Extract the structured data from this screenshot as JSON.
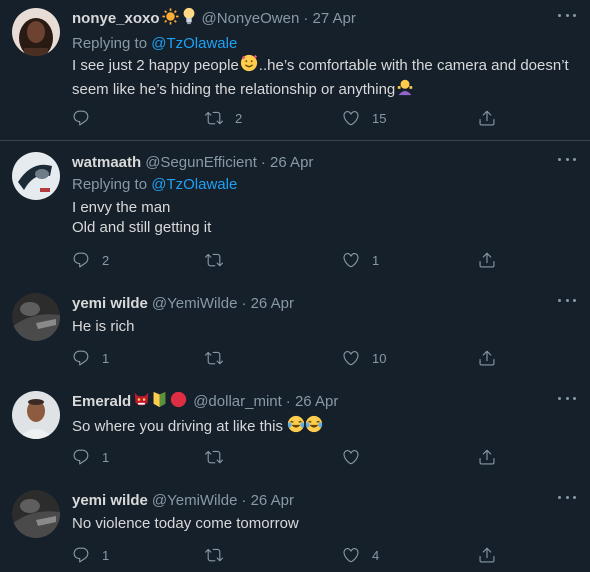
{
  "replying_to_label": "Replying to",
  "tweets": [
    {
      "name": "nonye_xoxo",
      "handle": "@NonyeOwen",
      "date": "· 27 Apr",
      "replying_to": "@TzOlawale",
      "lines": [
        "I see just 2 happy people",
        "..he’s comfortable with the camera and doesn’t",
        "seem like he’s hiding the relationship or anything"
      ],
      "name_emojis": [
        "sun-emoji",
        "lightbulb-emoji"
      ],
      "counts": {
        "reply": "",
        "retweet": "2",
        "like": "15"
      }
    },
    {
      "name": "watmaath",
      "handle": "@SegunEfficient",
      "date": "· 26 Apr",
      "replying_to": "@TzOlawale",
      "lines": [
        "I envy the man",
        "Old and still getting it"
      ],
      "counts": {
        "reply": "2",
        "retweet": "",
        "like": "1"
      }
    },
    {
      "name": "yemi wilde",
      "handle": "@YemiWilde",
      "date": "· 26 Apr",
      "lines": [
        "He is rich"
      ],
      "counts": {
        "reply": "1",
        "retweet": "",
        "like": "10"
      }
    },
    {
      "name": "Emerald",
      "handle": "@dollar_mint",
      "date": "· 26 Apr",
      "lines": [
        "So where you driving at like this"
      ],
      "name_emojis": [
        "ogre-emoji",
        "beginner-emoji",
        "red-circle-emoji"
      ],
      "counts": {
        "reply": "1",
        "retweet": "",
        "like": ""
      }
    },
    {
      "name": "yemi wilde",
      "handle": "@YemiWilde",
      "date": "· 26 Apr",
      "lines": [
        "No violence today come tomorrow"
      ],
      "counts": {
        "reply": "1",
        "retweet": "",
        "like": "4"
      }
    }
  ],
  "colors": {
    "background": "#15202b",
    "text": "#d9d9d9",
    "muted": "#8899a6",
    "link": "#1da1f2",
    "divider": "#38444d"
  }
}
